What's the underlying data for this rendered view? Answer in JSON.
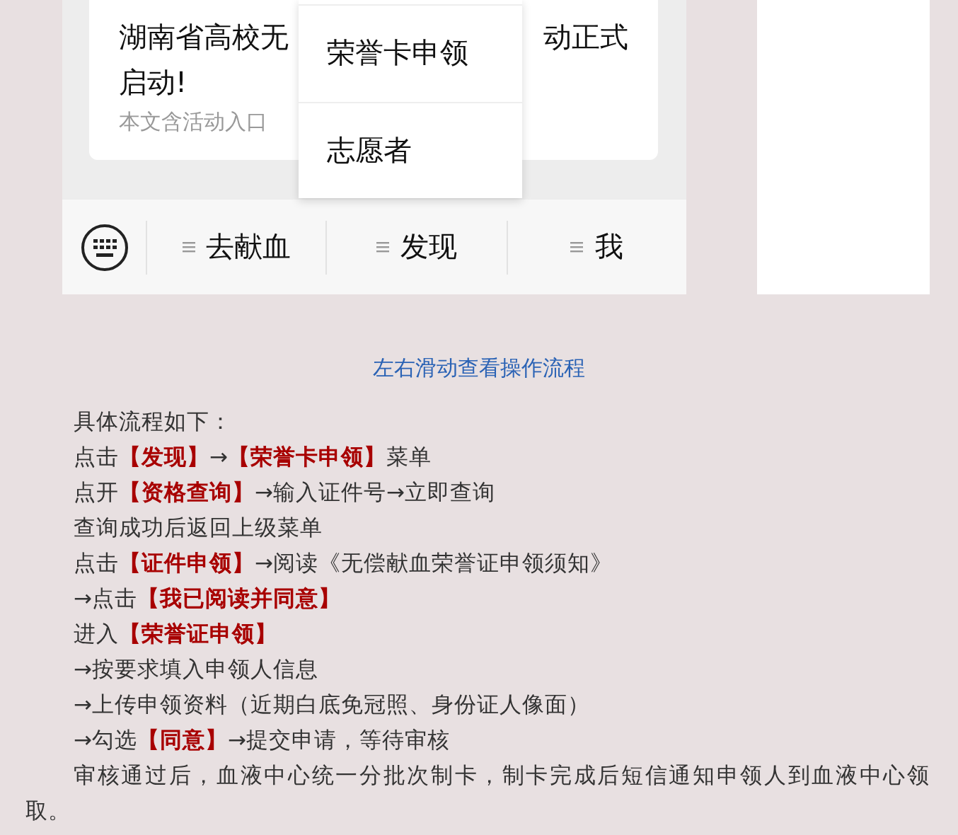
{
  "phone_screenshot": {
    "article_card": {
      "title_line_1_left": "湖南省高校无",
      "title_line_1_right": "动正式",
      "title_line_2": "启动!",
      "summary": "本文含活动入口"
    },
    "popup_menu": {
      "items": [
        {
          "label": "荣誉卡申领"
        },
        {
          "label": "志愿者"
        }
      ]
    },
    "menu_bar": {
      "items": [
        {
          "label": "去献血"
        },
        {
          "label": "发现"
        },
        {
          "label": "我"
        }
      ]
    }
  },
  "caption": "左右滑动查看操作流程",
  "paragraphs": [
    "具体流程如下：",
    "点击**【发现】**→**【荣誉卡申领】**菜单",
    "点开**【资格查询】**→输入证件号→立即查询",
    "查询成功后返回上级菜单",
    "点击**【证件申领】**→阅读《无偿献血荣誉证申领须知》",
    "→点击**【我已阅读并同意】**",
    "进入**【荣誉证申领】**",
    "→按要求填入申领人信息",
    "→上传申领资料（近期白底免冠照、身份证人像面）",
    "→勾选**【同意】**→提交申请，等待审核",
    "审核通过后，血液中心统一分批次制卡，制卡完成后短信通知申领人到血液中心领取。"
  ]
}
